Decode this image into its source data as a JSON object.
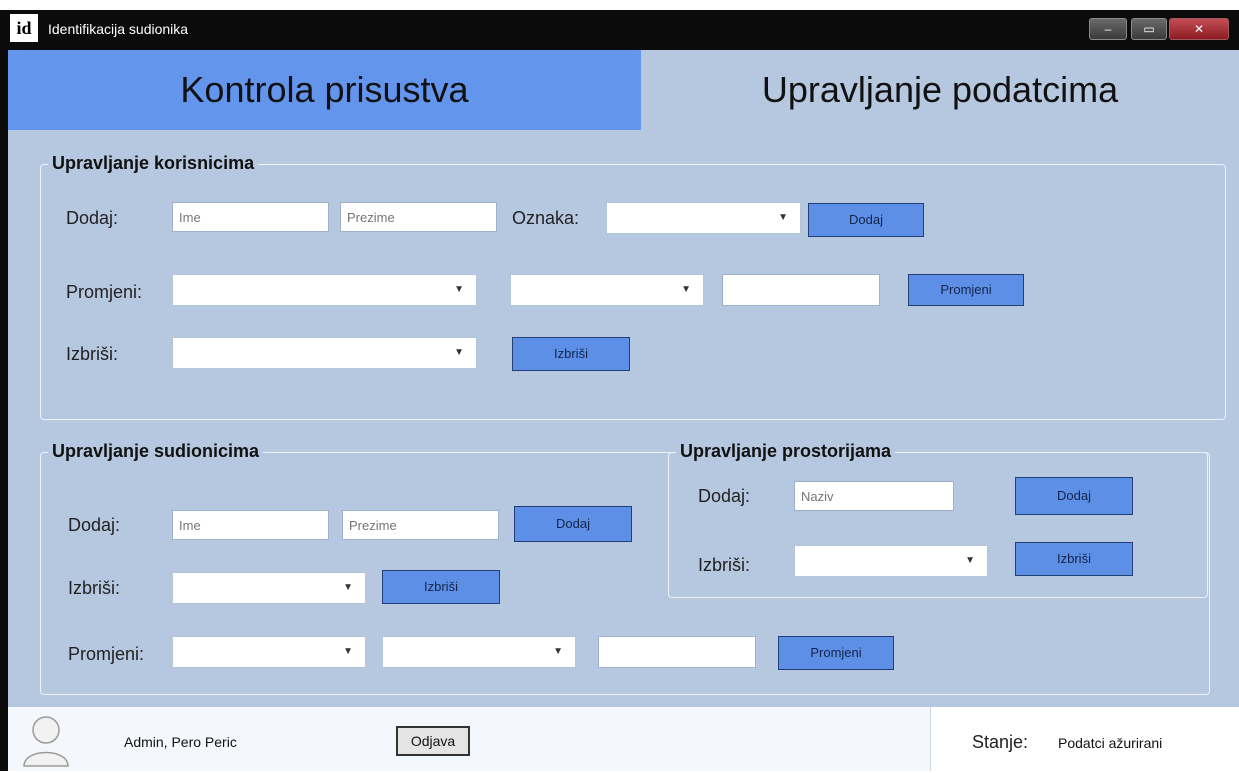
{
  "window": {
    "title": "Identifikacija sudionika",
    "icon_text": "id",
    "min": "–",
    "max": "▭",
    "close": "✕"
  },
  "tabs": {
    "kontrola": "Kontrola prisustva",
    "upravljanje": "Upravljanje podatcima"
  },
  "korisnici": {
    "legend": "Upravljanje korisnicima",
    "dodaj_label": "Dodaj:",
    "ime_placeholder": "Ime",
    "prezime_placeholder": "Prezime",
    "oznaka_label": "Oznaka:",
    "dodaj_button": "Dodaj",
    "promjeni_label": "Promjeni:",
    "promjeni_button": "Promjeni",
    "izbrisi_label": "Izbriši:",
    "izbrisi_button": "Izbriši"
  },
  "sudionici": {
    "legend": "Upravljanje sudionicima",
    "dodaj_label": "Dodaj:",
    "ime_placeholder": "Ime",
    "prezime_placeholder": "Prezime",
    "dodaj_button": "Dodaj",
    "izbrisi_label": "Izbriši:",
    "izbrisi_button": "Izbriši",
    "promjeni_label": "Promjeni:",
    "promjeni_button": "Promjeni"
  },
  "prostorije": {
    "legend": "Upravljanje prostorijama",
    "dodaj_label": "Dodaj:",
    "naziv_placeholder": "Naziv",
    "dodaj_button": "Dodaj",
    "izbrisi_label": "Izbriši:",
    "izbrisi_button": "Izbriši"
  },
  "status": {
    "user": "Admin, Pero Peric",
    "logout": "Odjava",
    "state_label": "Stanje:",
    "state_value": "Podatci ažurirani"
  },
  "colors": {
    "accent": "#6495ed",
    "background": "#b6c8e0",
    "button": "#5d8fe7"
  }
}
